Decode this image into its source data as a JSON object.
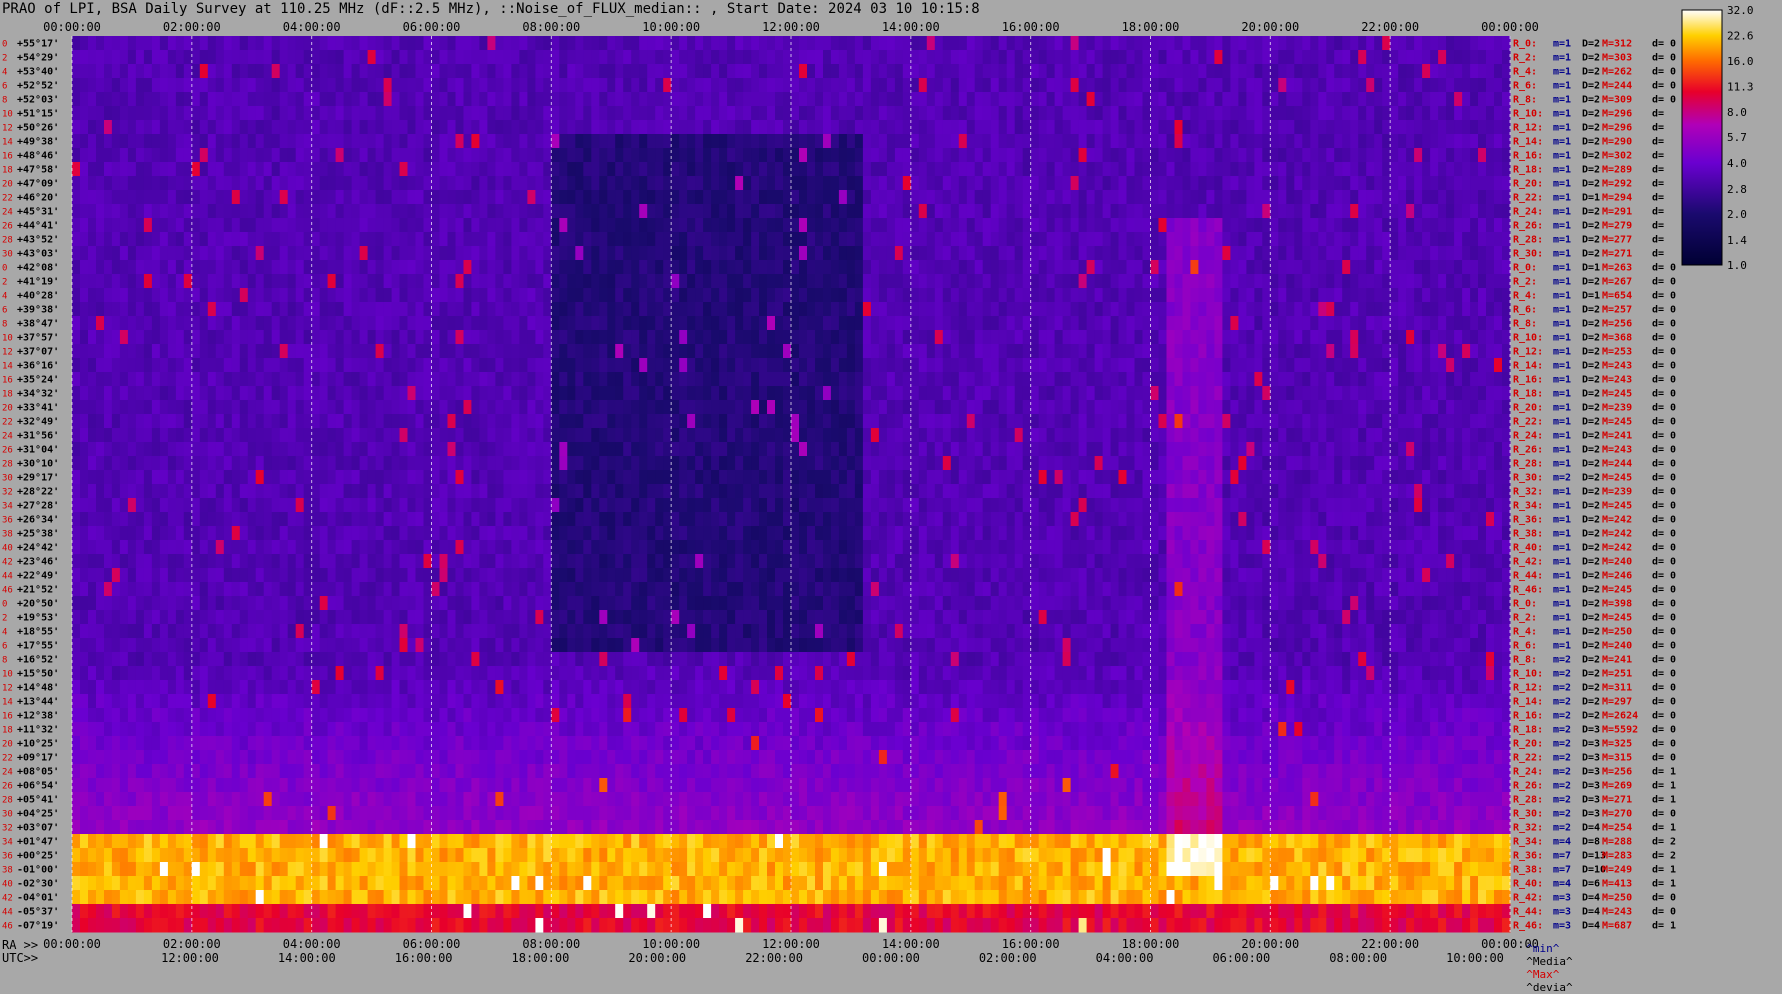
{
  "title": "PRAO of LPI, BSA Daily Survey at 110.25 MHz (dF::2.5 MHz), ::Noise_of_FLUX_median:: , Start Date: 2024 03 10 10:15:8",
  "ra_prefix": "RA >>",
  "utc_prefix": "UTC>>",
  "chart_data": {
    "type": "heatmap",
    "x_top_ticks": [
      "00:00:00",
      "02:00:00",
      "04:00:00",
      "06:00:00",
      "08:00:00",
      "10:00:00",
      "12:00:00",
      "14:00:00",
      "16:00:00",
      "18:00:00",
      "20:00:00",
      "22:00:00",
      "00:00:00"
    ],
    "x_ra_ticks": [
      "00:00:00",
      "02:00:00",
      "04:00:00",
      "06:00:00",
      "08:00:00",
      "10:00:00",
      "12:00:00",
      "14:00:00",
      "16:00:00",
      "18:00:00",
      "20:00:00",
      "22:00:00",
      "00:00:00"
    ],
    "x_utc_ticks": [
      "12:00:00",
      "14:00:00",
      "16:00:00",
      "18:00:00",
      "20:00:00",
      "22:00:00",
      "00:00:00",
      "02:00:00",
      "04:00:00",
      "06:00:00",
      "08:00:00",
      "10:00:00"
    ],
    "row_numbers": [
      "0",
      "2",
      "4",
      "6",
      "8",
      "10",
      "12",
      "14",
      "16",
      "18",
      "20",
      "22",
      "24",
      "26",
      "28",
      "30",
      "0",
      "2",
      "4",
      "6",
      "8",
      "10",
      "12",
      "14",
      "16",
      "18",
      "20",
      "22",
      "24",
      "26",
      "28",
      "30",
      "32",
      "34",
      "36",
      "38",
      "40",
      "42",
      "44",
      "46",
      "0",
      "2",
      "4",
      "6",
      "8",
      "10",
      "12",
      "14",
      "16",
      "18",
      "20",
      "22",
      "24",
      "26",
      "28",
      "30",
      "32",
      "34",
      "36",
      "38",
      "40",
      "42",
      "44",
      "46"
    ],
    "declinations": [
      "+55°17'",
      "+54°29'",
      "+53°40'",
      "+52°52'",
      "+52°03'",
      "+51°15'",
      "+50°26'",
      "+49°38'",
      "+48°46'",
      "+47°58'",
      "+47°09'",
      "+46°20'",
      "+45°31'",
      "+44°41'",
      "+43°52'",
      "+43°03'",
      "+42°08'",
      "+41°19'",
      "+40°28'",
      "+39°38'",
      "+38°47'",
      "+37°57'",
      "+37°07'",
      "+36°16'",
      "+35°24'",
      "+34°32'",
      "+33°41'",
      "+32°49'",
      "+31°56'",
      "+31°04'",
      "+30°10'",
      "+29°17'",
      "+28°22'",
      "+27°28'",
      "+26°34'",
      "+25°38'",
      "+24°42'",
      "+23°46'",
      "+22°49'",
      "+21°52'",
      "+20°50'",
      "+19°53'",
      "+18°55'",
      "+17°55'",
      "+16°52'",
      "+15°50'",
      "+14°48'",
      "+13°44'",
      "+12°38'",
      "+11°32'",
      "+10°25'",
      "+09°17'",
      "+08°05'",
      "+06°54'",
      "+05°41'",
      "+04°25'",
      "+03°07'",
      "+01°47'",
      "+00°25'",
      "-01°00'",
      "-02°30'",
      "-04°01'",
      "-05°37'",
      "-07°19'"
    ],
    "right_stats": [
      [
        "R_0:",
        "m=1",
        "D=2",
        "M=312",
        "d= 0"
      ],
      [
        "R_2:",
        "m=1",
        "D=2",
        "M=303",
        "d= 0"
      ],
      [
        "R_4:",
        "m=1",
        "D=2",
        "M=262",
        "d= 0"
      ],
      [
        "R_6:",
        "m=1",
        "D=2",
        "M=244",
        "d= 0"
      ],
      [
        "R_8:",
        "m=1",
        "D=2",
        "M=309",
        "d= 0"
      ],
      [
        "R_10:",
        "m=1",
        "D=2",
        "M=296",
        "d="
      ],
      [
        "R_12:",
        "m=1",
        "D=2",
        "M=296",
        "d="
      ],
      [
        "R_14:",
        "m=1",
        "D=2",
        "M=290",
        "d="
      ],
      [
        "R_16:",
        "m=1",
        "D=2",
        "M=302",
        "d="
      ],
      [
        "R_18:",
        "m=1",
        "D=2",
        "M=289",
        "d="
      ],
      [
        "R_20:",
        "m=1",
        "D=2",
        "M=292",
        "d="
      ],
      [
        "R_22:",
        "m=1",
        "D=1",
        "M=294",
        "d="
      ],
      [
        "R_24:",
        "m=1",
        "D=2",
        "M=291",
        "d="
      ],
      [
        "R_26:",
        "m=1",
        "D=2",
        "M=279",
        "d="
      ],
      [
        "R_28:",
        "m=1",
        "D=2",
        "M=277",
        "d="
      ],
      [
        "R_30:",
        "m=1",
        "D=2",
        "M=271",
        "d="
      ],
      [
        "R_0:",
        "m=1",
        "D=1",
        "M=263",
        "d= 0"
      ],
      [
        "R_2:",
        "m=1",
        "D=2",
        "M=267",
        "d= 0"
      ],
      [
        "R_4:",
        "m=1",
        "D=1",
        "M=654",
        "d= 0"
      ],
      [
        "R_6:",
        "m=1",
        "D=2",
        "M=257",
        "d= 0"
      ],
      [
        "R_8:",
        "m=1",
        "D=2",
        "M=256",
        "d= 0"
      ],
      [
        "R_10:",
        "m=1",
        "D=2",
        "M=368",
        "d= 0"
      ],
      [
        "R_12:",
        "m=1",
        "D=2",
        "M=253",
        "d= 0"
      ],
      [
        "R_14:",
        "m=1",
        "D=2",
        "M=243",
        "d= 0"
      ],
      [
        "R_16:",
        "m=1",
        "D=2",
        "M=243",
        "d= 0"
      ],
      [
        "R_18:",
        "m=1",
        "D=2",
        "M=245",
        "d= 0"
      ],
      [
        "R_20:",
        "m=1",
        "D=2",
        "M=239",
        "d= 0"
      ],
      [
        "R_22:",
        "m=1",
        "D=2",
        "M=245",
        "d= 0"
      ],
      [
        "R_24:",
        "m=1",
        "D=2",
        "M=241",
        "d= 0"
      ],
      [
        "R_26:",
        "m=1",
        "D=2",
        "M=243",
        "d= 0"
      ],
      [
        "R_28:",
        "m=1",
        "D=2",
        "M=244",
        "d= 0"
      ],
      [
        "R_30:",
        "m=2",
        "D=2",
        "M=245",
        "d= 0"
      ],
      [
        "R_32:",
        "m=1",
        "D=2",
        "M=239",
        "d= 0"
      ],
      [
        "R_34:",
        "m=1",
        "D=2",
        "M=245",
        "d= 0"
      ],
      [
        "R_36:",
        "m=1",
        "D=2",
        "M=242",
        "d= 0"
      ],
      [
        "R_38:",
        "m=1",
        "D=2",
        "M=242",
        "d= 0"
      ],
      [
        "R_40:",
        "m=1",
        "D=2",
        "M=242",
        "d= 0"
      ],
      [
        "R_42:",
        "m=1",
        "D=2",
        "M=240",
        "d= 0"
      ],
      [
        "R_44:",
        "m=1",
        "D=2",
        "M=246",
        "d= 0"
      ],
      [
        "R_46:",
        "m=1",
        "D=2",
        "M=245",
        "d= 0"
      ],
      [
        "R_0:",
        "m=1",
        "D=2",
        "M=398",
        "d= 0"
      ],
      [
        "R_2:",
        "m=1",
        "D=2",
        "M=245",
        "d= 0"
      ],
      [
        "R_4:",
        "m=1",
        "D=2",
        "M=250",
        "d= 0"
      ],
      [
        "R_6:",
        "m=1",
        "D=2",
        "M=240",
        "d= 0"
      ],
      [
        "R_8:",
        "m=2",
        "D=2",
        "M=241",
        "d= 0"
      ],
      [
        "R_10:",
        "m=2",
        "D=2",
        "M=251",
        "d= 0"
      ],
      [
        "R_12:",
        "m=2",
        "D=2",
        "M=311",
        "d= 0"
      ],
      [
        "R_14:",
        "m=2",
        "D=2",
        "M=297",
        "d= 0"
      ],
      [
        "R_16:",
        "m=2",
        "D=2",
        "M=2624",
        "d= 0"
      ],
      [
        "R_18:",
        "m=2",
        "D=3",
        "M=5592",
        "d= 0"
      ],
      [
        "R_20:",
        "m=2",
        "D=3",
        "M=325",
        "d= 0"
      ],
      [
        "R_22:",
        "m=2",
        "D=3",
        "M=315",
        "d= 0"
      ],
      [
        "R_24:",
        "m=2",
        "D=3",
        "M=256",
        "d= 1"
      ],
      [
        "R_26:",
        "m=2",
        "D=3",
        "M=269",
        "d= 1"
      ],
      [
        "R_28:",
        "m=2",
        "D=3",
        "M=271",
        "d= 1"
      ],
      [
        "R_30:",
        "m=2",
        "D=3",
        "M=270",
        "d= 0"
      ],
      [
        "R_32:",
        "m=2",
        "D=4",
        "M=254",
        "d= 1"
      ],
      [
        "R_34:",
        "m=4",
        "D=8",
        "M=288",
        "d= 2"
      ],
      [
        "R_36:",
        "m=7",
        "D=13",
        "M=283",
        "d= 2"
      ],
      [
        "R_38:",
        "m=7",
        "D=10",
        "M=249",
        "d= 1"
      ],
      [
        "R_40:",
        "m=4",
        "D=6",
        "M=413",
        "d= 1"
      ],
      [
        "R_42:",
        "m=3",
        "D=4",
        "M=250",
        "d= 0"
      ],
      [
        "R_44:",
        "m=3",
        "D=4",
        "M=243",
        "d= 0"
      ],
      [
        "R_46:",
        "m=3",
        "D=4",
        "M=687",
        "d= 1"
      ]
    ],
    "colorbar_ticks": [
      "32.0",
      "22.6",
      "16.0",
      "11.3",
      "8.0",
      "5.7",
      "4.0",
      "2.8",
      "2.0",
      "1.4",
      "1.0"
    ],
    "colorbar_scale": "log",
    "colorbar_range": [
      1.0,
      32.0
    ],
    "bottom_legend": [
      "^min^",
      "^Media^",
      "^Max^",
      "^devia^"
    ]
  },
  "colors": {
    "background": "#a8a8a8",
    "stat_label": "#d40000",
    "stat_m": "#00008b",
    "stat_d": "#000000",
    "stat_M": "#d40000"
  }
}
